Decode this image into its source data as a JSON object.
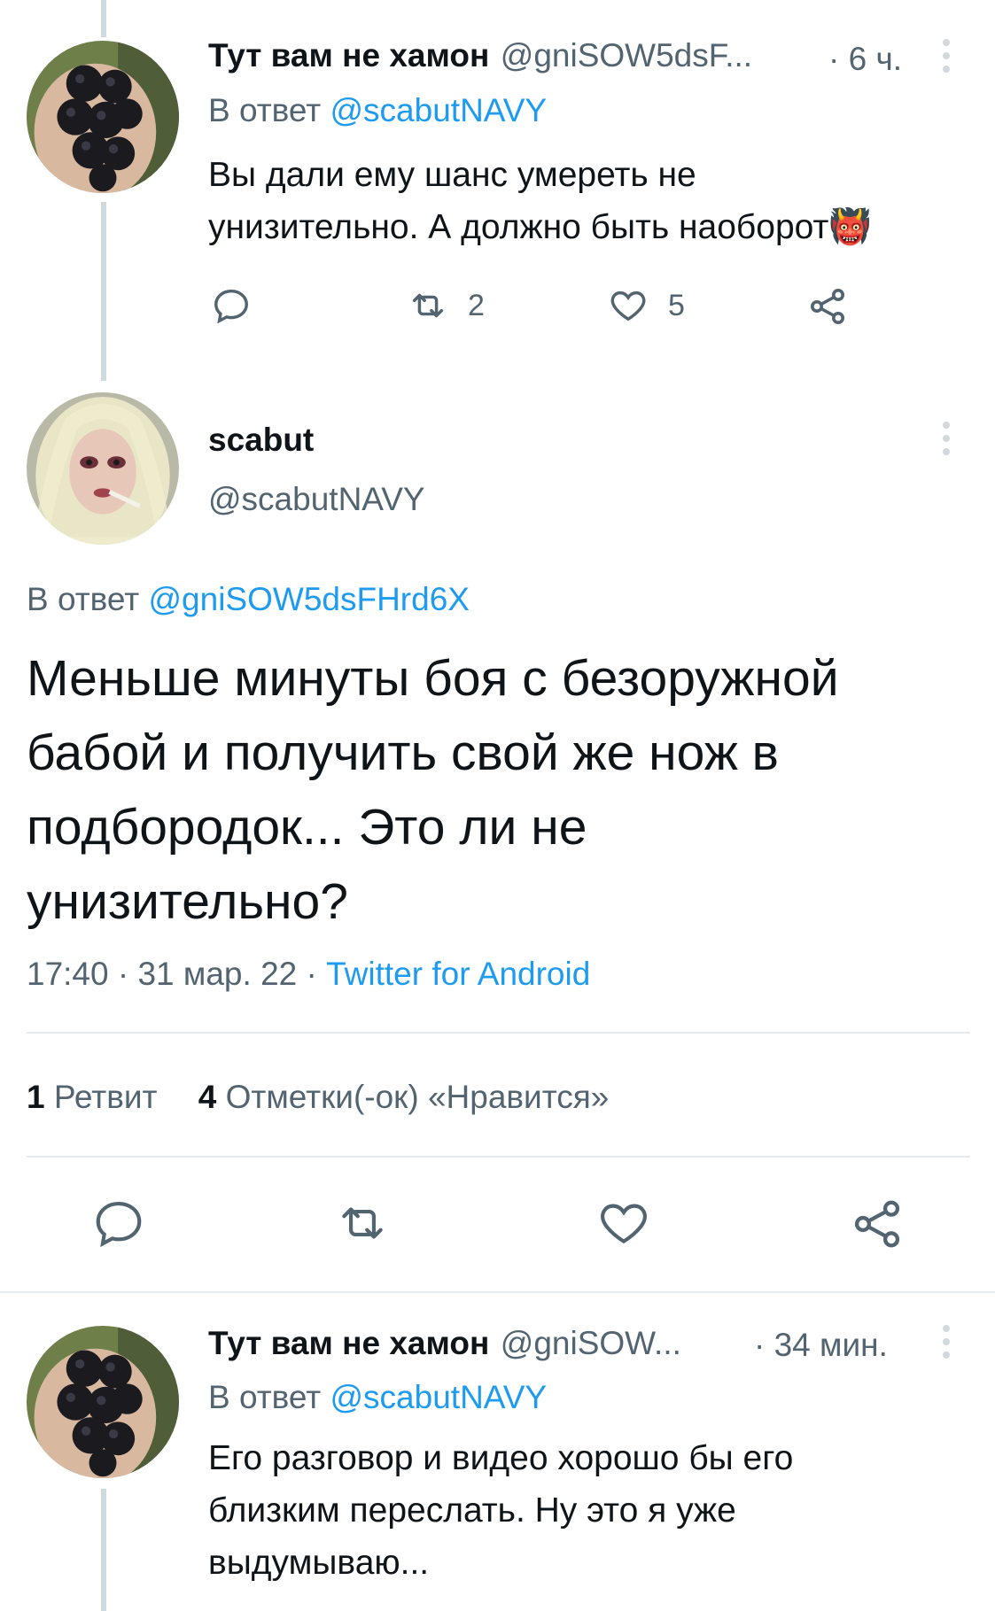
{
  "tweet1": {
    "name": "Тут вам не хамон",
    "handle": "@gniSOW5dsF...",
    "time": "· 6 ч.",
    "reply_prefix": "В ответ",
    "reply_to": "@scabutNAVY",
    "text_line1": "Вы дали ему шанс умереть не",
    "text_line2": "унизительно. А должно быть наоборот",
    "emoji": "👹",
    "retweets": "2",
    "likes": "5"
  },
  "main": {
    "name": "scabut",
    "handle": "@scabutNAVY",
    "reply_prefix": "В ответ",
    "reply_to": "@gniSOW5dsFHrd6X",
    "text_line1": "Меньше минуты боя с безоружной",
    "text_line2": "бабой и получить свой же нож в",
    "text_line3": "подбородок... Это ли не",
    "text_line4": "унизительно?",
    "time": "17:40",
    "date": "31 мар. 22",
    "sep": "·",
    "client": "Twitter for Android",
    "stats": {
      "retweets_count": "1",
      "retweets_label": "Ретвит",
      "likes_count": "4",
      "likes_label": "Отметки(-ок) «Нравится»"
    }
  },
  "tweet3": {
    "name": "Тут вам не хамон",
    "handle": "@gniSOW...",
    "time": "· 34 мин.",
    "reply_prefix": "В ответ",
    "reply_to": "@scabutNAVY",
    "text_line1": "Его разговор и видео хорошо бы его",
    "text_line2": "близким переслать. Ну это я уже",
    "text_line3": "выдумываю..."
  },
  "colors": {
    "link": "#1d9bf0",
    "secondary_text": "#536471",
    "primary_text": "#0f1419",
    "thread_line": "#cfd9de"
  },
  "icons": [
    "reply-icon",
    "retweet-icon",
    "like-icon",
    "share-icon",
    "more-icon"
  ]
}
